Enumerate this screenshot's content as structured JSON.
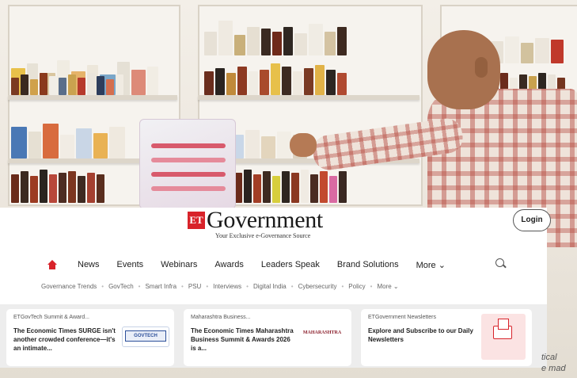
{
  "brand": {
    "logo_mark": "ET",
    "logo_word": "Government",
    "tagline": "Your Exclusive e-Governance Source",
    "accent_color": "#d8232a"
  },
  "header": {
    "login_label": "Login",
    "search_icon": "search-icon"
  },
  "nav": {
    "home_icon": "home-icon",
    "items": [
      "News",
      "Events",
      "Webinars",
      "Awards",
      "Leaders Speak",
      "Brand Solutions"
    ],
    "more_label": "More ⌄"
  },
  "subnav": {
    "items": [
      "Governance Trends",
      "GovTech",
      "Smart Infra",
      "PSU",
      "Interviews",
      "Digital India",
      "Cybersecurity",
      "Policy",
      "More ⌄"
    ]
  },
  "cards": [
    {
      "category": "ETGovTech Summit & Award...",
      "title": "The Economic Times SURGE isn't another crowded conference—it's an intimate...",
      "thumb_label": "GOVTECH"
    },
    {
      "category": "Maharashtra Business...",
      "title": "The Economic Times Maharashtra Business Summit & Awards 2026 is a...",
      "thumb_label": "MAHARASHTRA"
    },
    {
      "category": "ETGovernment Newsletters",
      "title": "Explore and Subscribe to our Daily Newsletters",
      "thumb_icon": "newsletter-mail-icon"
    }
  ],
  "side_text": [
    "tical",
    "e mad"
  ]
}
